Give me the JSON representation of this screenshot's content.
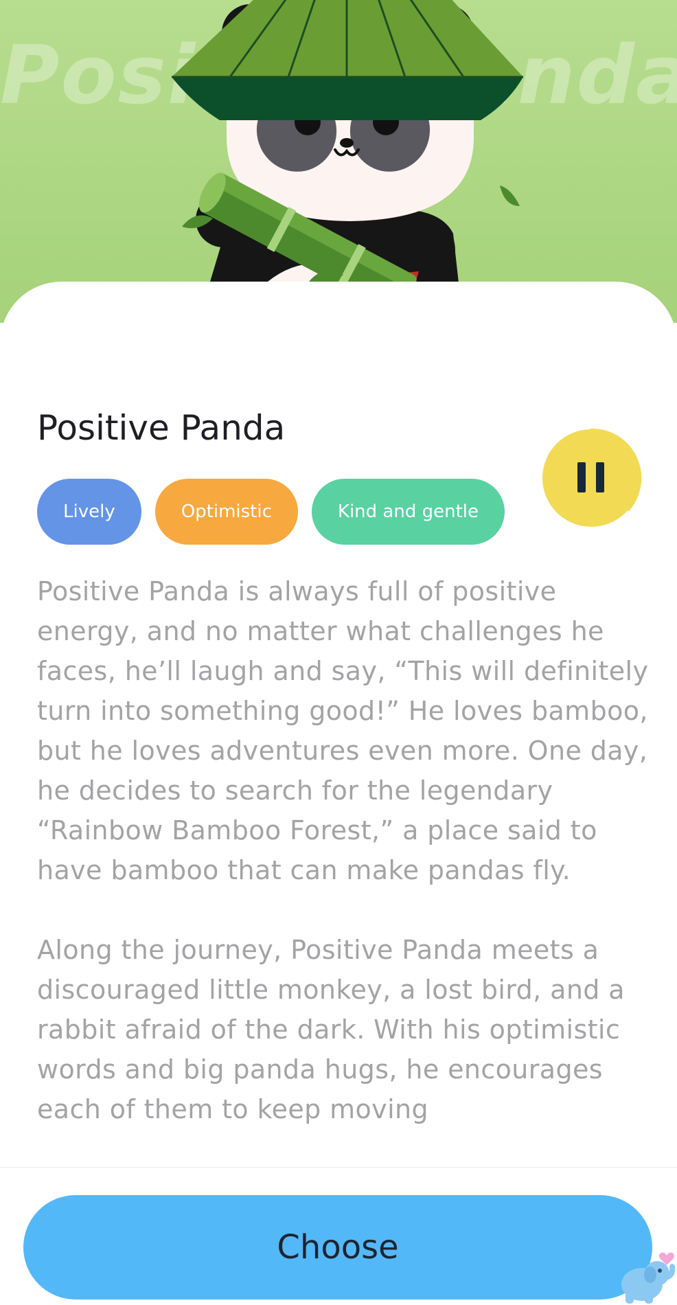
{
  "hero": {
    "watermark_title": "Positive Panda",
    "illustration": "panda-with-bamboo-hat-illustration"
  },
  "character": {
    "name": "Positive Panda",
    "tags": [
      "Lively",
      "Optimistic",
      "Kind and gentle"
    ]
  },
  "audio": {
    "icon": "pause-icon",
    "state": "playing"
  },
  "story": {
    "paragraphs": [
      "Positive Panda is always full of positive energy, and no matter what challenges he faces, he’ll laugh and say, “This will definitely turn into something good!” He loves bamboo, but he loves adventures even more. One day, he decides to search for the legendary “Rainbow Bamboo Forest,” a place said to have bamboo that can make pandas fly.",
      "Along the journey, Positive Panda meets a discouraged little monkey, a lost bird, and a rabbit afraid of the dark. With his optimistic words and big panda hugs, he encourages each of them to keep moving"
    ]
  },
  "footer": {
    "choose_label": "Choose",
    "mascot_icon": "elephant-heart-icon"
  },
  "colors": {
    "hero_background": "#a6d27a",
    "tag_lively": "#6394e6",
    "tag_optimistic": "#f7a83f",
    "tag_kind": "#5ad1a1",
    "pause_button": "#f2da55",
    "choose_button": "#53b8f7",
    "body_text": "#a3a3a6"
  }
}
